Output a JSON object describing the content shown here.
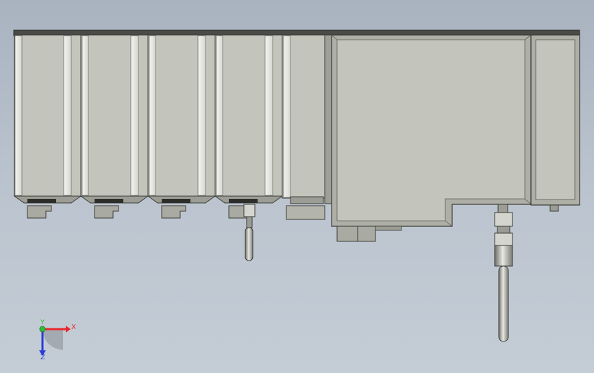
{
  "view": {
    "background_top": "#a9b3c0",
    "background_bottom": "#c4ccd6"
  },
  "model": {
    "body_fill": "#c3c4bb",
    "body_shade": "#aeafa6",
    "edge_color": "#3a3b36",
    "top_rail": "#4a4b46",
    "small_module_count": 4
  },
  "triad": {
    "x_label": "X",
    "y_label": "Y",
    "z_label": "Z",
    "x_color": "#e8262a",
    "y_color": "#2fbf3a",
    "z_color": "#2a3bd8"
  }
}
